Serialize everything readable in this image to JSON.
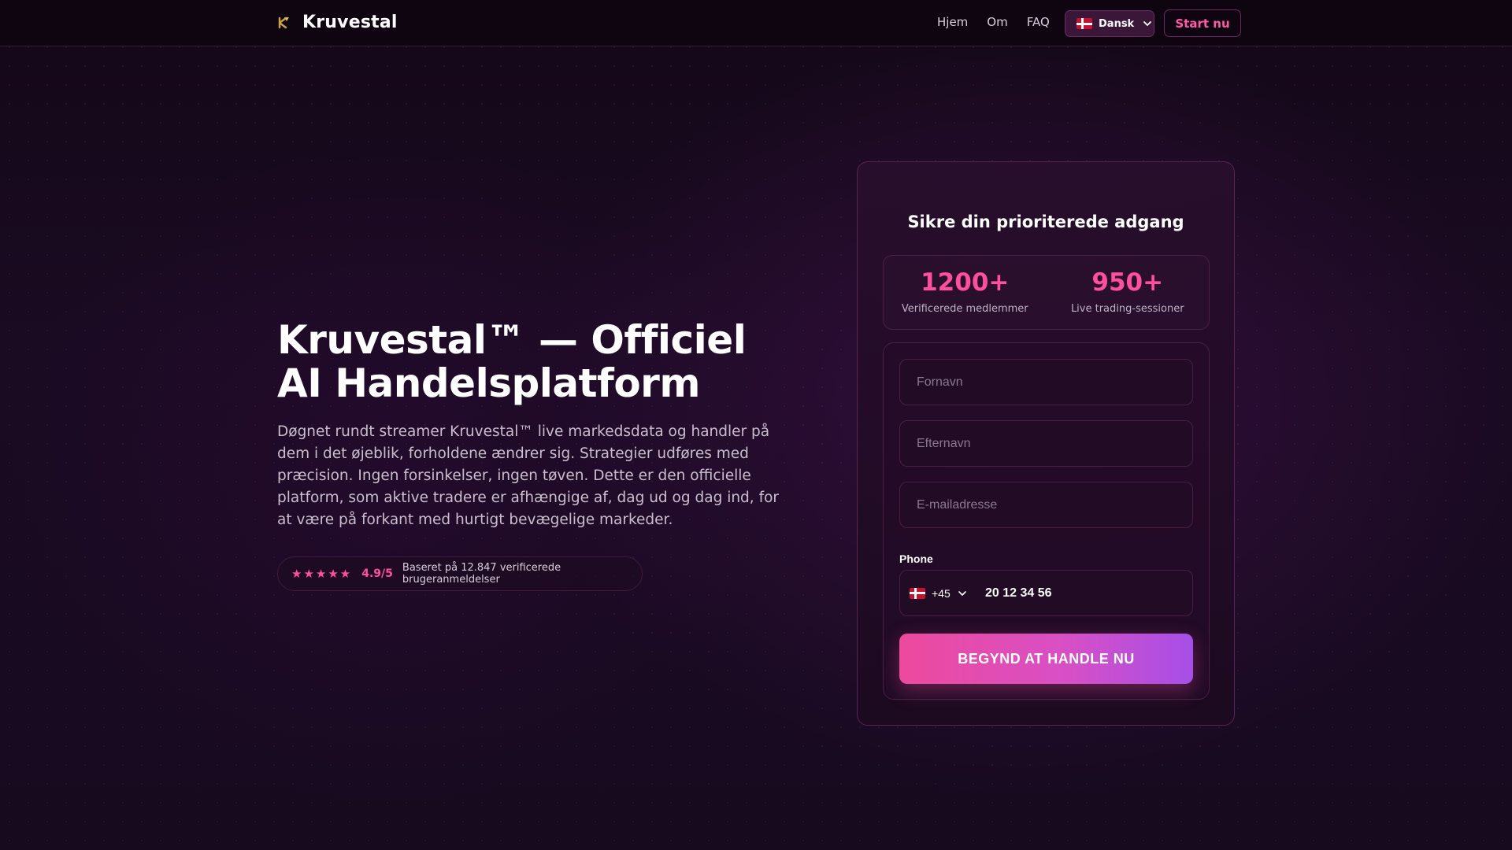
{
  "nav": {
    "brand": "Kruvestal",
    "links": [
      "Hjem",
      "Om",
      "FAQ"
    ],
    "language": "Dansk",
    "start_label": "Start nu"
  },
  "hero": {
    "title": "Kruvestal™ — Officiel AI Handelsplatform",
    "description": "Døgnet rundt streamer Kruvestal™ live markedsdata og handler på dem i det øjeblik, forholdene ændrer sig. Strategier udføres med præcision. Ingen forsinkelser, ingen tøven. Dette er den officielle platform, som aktive tradere er afhængige af, dag ud og dag ind, for at være på forkant med hurtigt bevægelige markeder.",
    "rating": {
      "stars": 5,
      "score": "4.9/5",
      "text": "Baseret på 12.847 verificerede brugeranmeldelser"
    }
  },
  "card": {
    "title": "Sikre din prioriterede adgang",
    "stats": [
      {
        "value": "1200+",
        "label": "Verificerede medlemmer"
      },
      {
        "value": "950+",
        "label": "Live trading-sessioner"
      }
    ],
    "form": {
      "first_name_placeholder": "Fornavn",
      "last_name_placeholder": "Efternavn",
      "email_placeholder": "E-mailadresse",
      "phone_label": "Phone",
      "country_code": "+45",
      "phone_value": "20 12 34 56",
      "submit_label": "BEGYND AT HANDLE NU"
    }
  },
  "colors": {
    "accent": "#ff4f9e",
    "cta_gradient_start": "#ec4a9c",
    "cta_gradient_end": "#a64fe8",
    "background": "#170a1f"
  },
  "icons": [
    "kruvestal-logo-icon",
    "denmark-flag-icon",
    "chevron-down-icon",
    "star-icon"
  ]
}
